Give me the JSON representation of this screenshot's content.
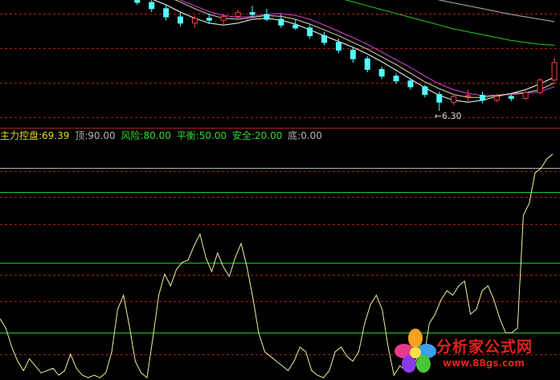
{
  "indicator": {
    "name_label": "主力控盘:",
    "value": "69.39",
    "levels": [
      {
        "label": "顶:",
        "value": "90.00",
        "color": "#b4b4b4"
      },
      {
        "label": "风险:",
        "value": "80.00",
        "color": "#34d834"
      },
      {
        "label": "平衡:",
        "value": "50.00",
        "color": "#34d834"
      },
      {
        "label": "安全:",
        "value": "20.00",
        "color": "#34d834"
      },
      {
        "label": "底:",
        "value": "0.00",
        "color": "#b4b4b4"
      }
    ],
    "name_color": "#dcdc1e",
    "value_color": "#dcdc1e"
  },
  "price_annotation": "←6.30",
  "watermark": {
    "title": "分析家公式网",
    "url": "www.88gs.com"
  },
  "chart_data": [
    {
      "type": "candlestick",
      "title": "",
      "low_marker": 6.3,
      "ylim": [
        6.1,
        8.6
      ],
      "moving_averages": [
        {
          "color": "#ffffff",
          "values": [
            8.85,
            8.8,
            8.72,
            8.62,
            8.5,
            8.35,
            8.22,
            8.12,
            8.08,
            8.12,
            8.2,
            8.22,
            8.18,
            8.1,
            7.98,
            7.86,
            7.74,
            7.62,
            7.48,
            7.32,
            7.14,
            6.96,
            6.78,
            6.62,
            6.52,
            6.48,
            6.52,
            6.6,
            6.66,
            6.74,
            6.86,
            7.0
          ]
        },
        {
          "color": "#e040e0",
          "values": [
            8.9,
            8.85,
            8.8,
            8.75,
            8.7,
            8.6,
            8.48,
            8.36,
            8.28,
            8.24,
            8.26,
            8.3,
            8.32,
            8.28,
            8.2,
            8.08,
            7.95,
            7.82,
            7.68,
            7.52,
            7.36,
            7.2,
            7.02,
            6.86,
            6.74,
            6.66,
            6.62,
            6.62,
            6.64,
            6.66,
            6.7,
            6.8
          ]
        },
        {
          "color": "#d8d8a0",
          "values": [
            8.95,
            8.9,
            8.85,
            8.78,
            8.68,
            8.56,
            8.42,
            8.3,
            8.22,
            8.2,
            8.24,
            8.28,
            8.26,
            8.2,
            8.1,
            7.98,
            7.86,
            7.72,
            7.58,
            7.42,
            7.26,
            7.08,
            6.9,
            6.76,
            6.64,
            6.58,
            6.58,
            6.62,
            6.66,
            6.68,
            6.74,
            6.88
          ]
        },
        {
          "color": "#22cc22",
          "values": [
            9.5,
            9.45,
            9.4,
            9.35,
            9.3,
            9.25,
            9.2,
            9.15,
            9.1,
            9.05,
            9.0,
            8.95,
            8.9,
            8.84,
            8.78,
            8.71,
            8.64,
            8.56,
            8.48,
            8.4,
            8.32,
            8.24,
            8.16,
            8.08,
            8.0,
            7.94,
            7.88,
            7.82,
            7.76,
            7.72,
            7.68,
            7.66
          ]
        },
        {
          "color": "#b4b4b4",
          "values": [
            10.2,
            10.12,
            10.05,
            9.98,
            9.9,
            9.82,
            9.75,
            9.68,
            9.6,
            9.53,
            9.46,
            9.39,
            9.32,
            9.25,
            9.18,
            9.11,
            9.04,
            8.97,
            8.9,
            8.84,
            8.78,
            8.72,
            8.66,
            8.6,
            8.54,
            8.48,
            8.42,
            8.36,
            8.3,
            8.25,
            8.2,
            8.15
          ]
        }
      ],
      "candles": [
        {
          "o": 8.9,
          "h": 9.0,
          "l": 8.75,
          "c": 8.8
        },
        {
          "o": 8.8,
          "h": 8.9,
          "l": 8.62,
          "c": 8.66
        },
        {
          "o": 8.66,
          "h": 8.75,
          "l": 8.5,
          "c": 8.55
        },
        {
          "o": 8.55,
          "h": 8.62,
          "l": 8.35,
          "c": 8.42
        },
        {
          "o": 8.42,
          "h": 8.5,
          "l": 8.18,
          "c": 8.25
        },
        {
          "o": 8.25,
          "h": 8.35,
          "l": 8.05,
          "c": 8.12
        },
        {
          "o": 8.12,
          "h": 8.28,
          "l": 8.02,
          "c": 8.22
        },
        {
          "o": 8.22,
          "h": 8.32,
          "l": 8.1,
          "c": 8.18
        },
        {
          "o": 8.18,
          "h": 8.3,
          "l": 8.08,
          "c": 8.26
        },
        {
          "o": 8.26,
          "h": 8.4,
          "l": 8.2,
          "c": 8.34
        },
        {
          "o": 8.34,
          "h": 8.48,
          "l": 8.24,
          "c": 8.3
        },
        {
          "o": 8.3,
          "h": 8.42,
          "l": 8.16,
          "c": 8.2
        },
        {
          "o": 8.2,
          "h": 8.3,
          "l": 8.02,
          "c": 8.08
        },
        {
          "o": 8.08,
          "h": 8.2,
          "l": 7.98,
          "c": 8.02
        },
        {
          "o": 8.02,
          "h": 8.08,
          "l": 7.8,
          "c": 7.86
        },
        {
          "o": 7.86,
          "h": 7.94,
          "l": 7.66,
          "c": 7.72
        },
        {
          "o": 7.72,
          "h": 7.8,
          "l": 7.5,
          "c": 7.56
        },
        {
          "o": 7.56,
          "h": 7.62,
          "l": 7.3,
          "c": 7.38
        },
        {
          "o": 7.38,
          "h": 7.44,
          "l": 7.1,
          "c": 7.16
        },
        {
          "o": 7.16,
          "h": 7.22,
          "l": 6.96,
          "c": 7.02
        },
        {
          "o": 7.02,
          "h": 7.08,
          "l": 6.86,
          "c": 6.92
        },
        {
          "o": 6.92,
          "h": 6.98,
          "l": 6.74,
          "c": 6.8
        },
        {
          "o": 6.8,
          "h": 6.84,
          "l": 6.58,
          "c": 6.64
        },
        {
          "o": 6.64,
          "h": 6.7,
          "l": 6.3,
          "c": 6.48
        },
        {
          "o": 6.48,
          "h": 6.66,
          "l": 6.42,
          "c": 6.6
        },
        {
          "o": 6.6,
          "h": 6.74,
          "l": 6.5,
          "c": 6.62
        },
        {
          "o": 6.62,
          "h": 6.7,
          "l": 6.46,
          "c": 6.52
        },
        {
          "o": 6.52,
          "h": 6.66,
          "l": 6.48,
          "c": 6.6
        },
        {
          "o": 6.6,
          "h": 6.64,
          "l": 6.5,
          "c": 6.56
        },
        {
          "o": 6.56,
          "h": 6.72,
          "l": 6.52,
          "c": 6.68
        },
        {
          "o": 6.68,
          "h": 6.98,
          "l": 6.64,
          "c": 6.94
        },
        {
          "o": 6.94,
          "h": 7.4,
          "l": 6.9,
          "c": 7.3
        }
      ]
    },
    {
      "type": "line",
      "title": "主力控盘",
      "ylim": [
        0,
        100
      ],
      "reference_levels": [
        {
          "name": "顶",
          "value": 90,
          "color": "#b4b4b4"
        },
        {
          "name": "风险",
          "value": 80,
          "color": "#22cc22"
        },
        {
          "name": "平衡",
          "value": 50,
          "color": "#22cc22"
        },
        {
          "name": "安全",
          "value": 20,
          "color": "#22cc22"
        },
        {
          "name": "底",
          "value": 0,
          "color": "#b4b4b4"
        }
      ],
      "series": [
        {
          "color": "#f0f0a0",
          "values": [
            26,
            22,
            14,
            8,
            4,
            9,
            6,
            3,
            4,
            5,
            2,
            4,
            11,
            5,
            2,
            1,
            2,
            1,
            3,
            12,
            30,
            36,
            23,
            8,
            3,
            1,
            18,
            36,
            45,
            40,
            47,
            50,
            51,
            57,
            62,
            52,
            46,
            54,
            48,
            44,
            52,
            58,
            48,
            35,
            20,
            12,
            10,
            8,
            6,
            4,
            8,
            14,
            12,
            4,
            2,
            1,
            4,
            12,
            14,
            10,
            8,
            12,
            24,
            32,
            36,
            30,
            14,
            2,
            6,
            4,
            4,
            10,
            8,
            24,
            28,
            34,
            38,
            36,
            40,
            42,
            28,
            30,
            38,
            40,
            34,
            26,
            20,
            20,
            22,
            70,
            75,
            88,
            90,
            94,
            96
          ]
        }
      ],
      "last_value": 69.39
    }
  ]
}
